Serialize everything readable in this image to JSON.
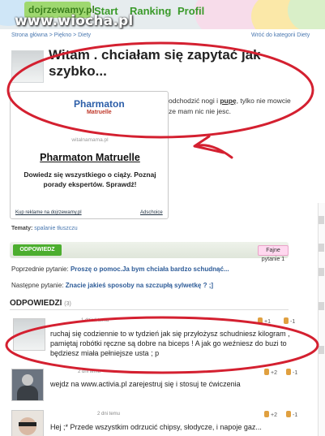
{
  "header": {
    "logo": "dojrzewamy.pl",
    "nav": [
      "Start",
      "Ranking",
      "Profil"
    ],
    "watermark": "www.wiocha.pl"
  },
  "breadcrumb": "Strona główna > Piękno > Diety",
  "back_link": "Wróć do kategorii Diety",
  "question": {
    "title": "Witam . chciałam się zapytać jak szybko...",
    "body_line1_pre": "odchodzić nogi i ",
    "body_line1_bold": "pupę",
    "body_line1_post": ", tylko nie mowcie",
    "body_line2": "ze mam nic nie jesc."
  },
  "ad": {
    "logo_top": "Pharmaton",
    "logo_bottom": "Matruelle",
    "url": "witalnamama.pl",
    "title": "Pharmaton Matruelle",
    "description": "Dowiedz się wszystkiego o ciąży. Poznaj porady ekspertów. Sprawdź!",
    "buy_link": "Kup reklame na dojrzewamy.pl",
    "choices_link": "Adschoice"
  },
  "tags": {
    "label": "Tematy:",
    "value": "spalanie tłuszczu"
  },
  "answer_button": "ODPOWIEDZ",
  "fajne_button": "Fajne pytanie 1",
  "prev_question": {
    "label": "Poprzednie pytanie:",
    "title": "Proszę o pomoc.Ja bym chciała bardzo schudnąć..."
  },
  "next_question": {
    "label": "Następne pytanie:",
    "title": "Znacie jakieś sposoby na szczupłą sylwetkę ? ;]"
  },
  "answers_heading": "ODPOWIEDZI",
  "answers_count": "(3)",
  "answers": [
    {
      "time": "1 dzień temu",
      "text": "ruchaj się codziennie to w tydzień jak się przyłożysz schudniesz kilogram , pamiętaj robótki ręczne są dobre na biceps ! A jak go weźniesz do buzi to będziesz miała pełniejsze usta ; p",
      "up": "+1",
      "down": "-1"
    },
    {
      "time": "2 dni temu",
      "text": "wejdz na www.activia.pl zarejestruj się i stosuj te ćwiczenia",
      "up": "+2",
      "down": "-1"
    },
    {
      "time": "2 dni temu",
      "text": "Hej ;* Przede wszystkim odrzucić chipsy, słodycze, i napoje gaz...",
      "up": "+2",
      "down": "-1"
    }
  ],
  "colors": {
    "accent_green": "#4cae2e",
    "link_blue": "#2e5c98",
    "annotation_red": "#d42030"
  }
}
